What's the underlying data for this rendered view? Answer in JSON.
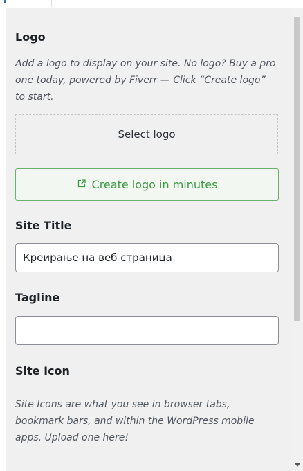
{
  "logo": {
    "title": "Logo",
    "description": "Add a logo to display on your site. No logo? Buy a pro one today, powered by Fiverr — Click “Create logo” to start.",
    "select_label": "Select logo",
    "create_label": "Create logo in minutes"
  },
  "site_title": {
    "label": "Site Title",
    "value": "Креирање на веб страница"
  },
  "tagline": {
    "label": "Tagline",
    "value": ""
  },
  "site_icon": {
    "title": "Site Icon",
    "description": "Site Icons are what you see in browser tabs, bookmark bars, and within the WordPress mobile apps. Upload one here!"
  },
  "icons": {
    "create_logo_icon": "external-link-icon",
    "scroll_down_icon": "caret-down-icon"
  },
  "colors": {
    "panel_bg": "#f0f0f1",
    "create_logo_accent": "#3f9a46",
    "create_logo_border": "#69b36e"
  }
}
